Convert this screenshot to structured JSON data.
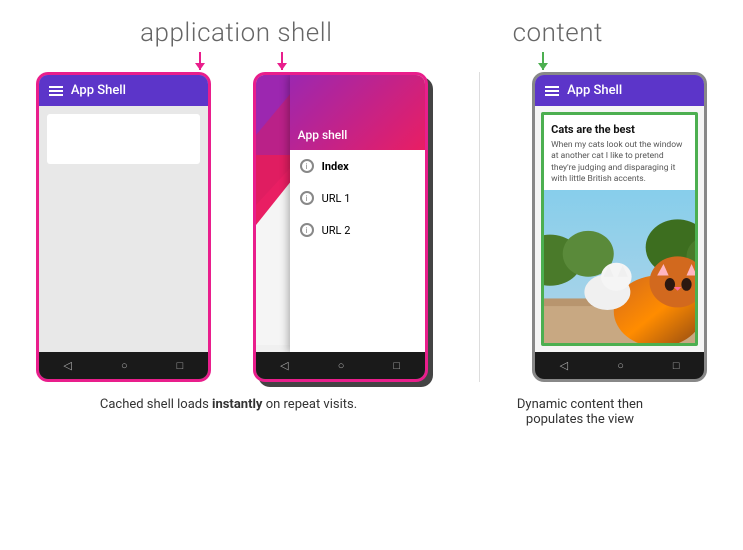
{
  "labels": {
    "application_shell": "application shell",
    "content": "content"
  },
  "phone1": {
    "app_bar_title": "App Shell",
    "nav": [
      "◁",
      "○",
      "□"
    ]
  },
  "phone2": {
    "menu_header": "App shell",
    "menu_items": [
      {
        "label": "Index",
        "bold": true
      },
      {
        "label": "URL 1",
        "bold": false
      },
      {
        "label": "URL 2",
        "bold": false
      }
    ],
    "nav": [
      "◁",
      "○",
      "□"
    ]
  },
  "phone3": {
    "app_bar_title": "App Shell",
    "card_title": "Cats are the best",
    "card_desc": "When my cats look out the window at another cat I like to pretend they're judging and disparaging it with little British accents.",
    "nav": [
      "◁",
      "○",
      "□"
    ]
  },
  "captions": {
    "left": "Cached shell loads ",
    "left_bold": "instantly",
    "left_end": " on repeat visits.",
    "right_line1": "Dynamic content then",
    "right_line2": "populates the view"
  }
}
